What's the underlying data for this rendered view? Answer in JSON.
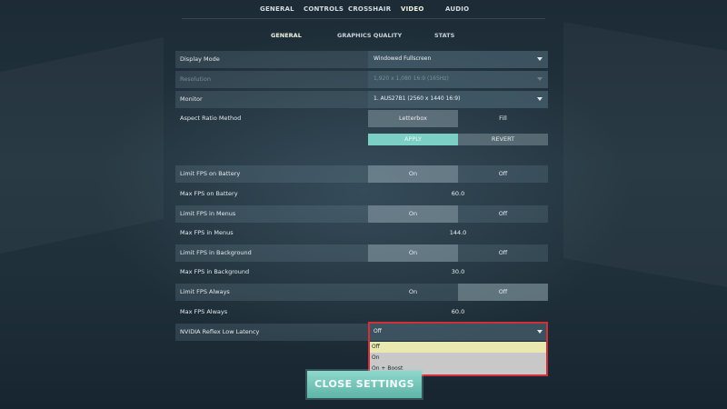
{
  "top_tabs": [
    "GENERAL",
    "CONTROLS",
    "CROSSHAIR",
    "VIDEO",
    "AUDIO"
  ],
  "top_active": "VIDEO",
  "sub_tabs": [
    "GENERAL",
    "GRAPHICS QUALITY",
    "STATS"
  ],
  "sub_active": "GENERAL",
  "settings": {
    "display_mode": {
      "label": "Display Mode",
      "value": "Windowed Fullscreen"
    },
    "resolution": {
      "label": "Resolution",
      "value": "1,920 x 1,080 16:9 (165Hz)"
    },
    "monitor": {
      "label": "Monitor",
      "value": "1. AUS27B1 (2560 x 1440 16:9)"
    },
    "aspect_ratio": {
      "label": "Aspect Ratio Method",
      "opt1": "Letterbox",
      "opt2": "Fill"
    },
    "apply_label": "APPLY",
    "revert_label": "REVERT",
    "limit_fps_battery": {
      "label": "Limit FPS on Battery",
      "opt1": "On",
      "opt2": "Off"
    },
    "max_fps_battery": {
      "label": "Max FPS on Battery",
      "value": "60.0"
    },
    "limit_fps_menus": {
      "label": "Limit FPS in Menus",
      "opt1": "On",
      "opt2": "Off"
    },
    "max_fps_menus": {
      "label": "Max FPS in Menus",
      "value": "144.0"
    },
    "limit_fps_background": {
      "label": "Limit FPS in Background",
      "opt1": "On",
      "opt2": "Off"
    },
    "max_fps_background": {
      "label": "Max FPS in Background",
      "value": "30.0"
    },
    "limit_fps_always": {
      "label": "Limit FPS Always",
      "opt1": "On",
      "opt2": "Off"
    },
    "max_fps_always": {
      "label": "Max FPS Always",
      "value": "60.0"
    },
    "nvidia_reflex": {
      "label": "NVIDIA Reflex Low Latency",
      "value": "Off",
      "options": [
        "Off",
        "On",
        "On + Boost"
      ]
    }
  },
  "close_label": "CLOSE SETTINGS",
  "colors": {
    "accent": "#7ccfc4",
    "highlight_border": "#d0303a",
    "selected_option": "#e8e8b0"
  }
}
